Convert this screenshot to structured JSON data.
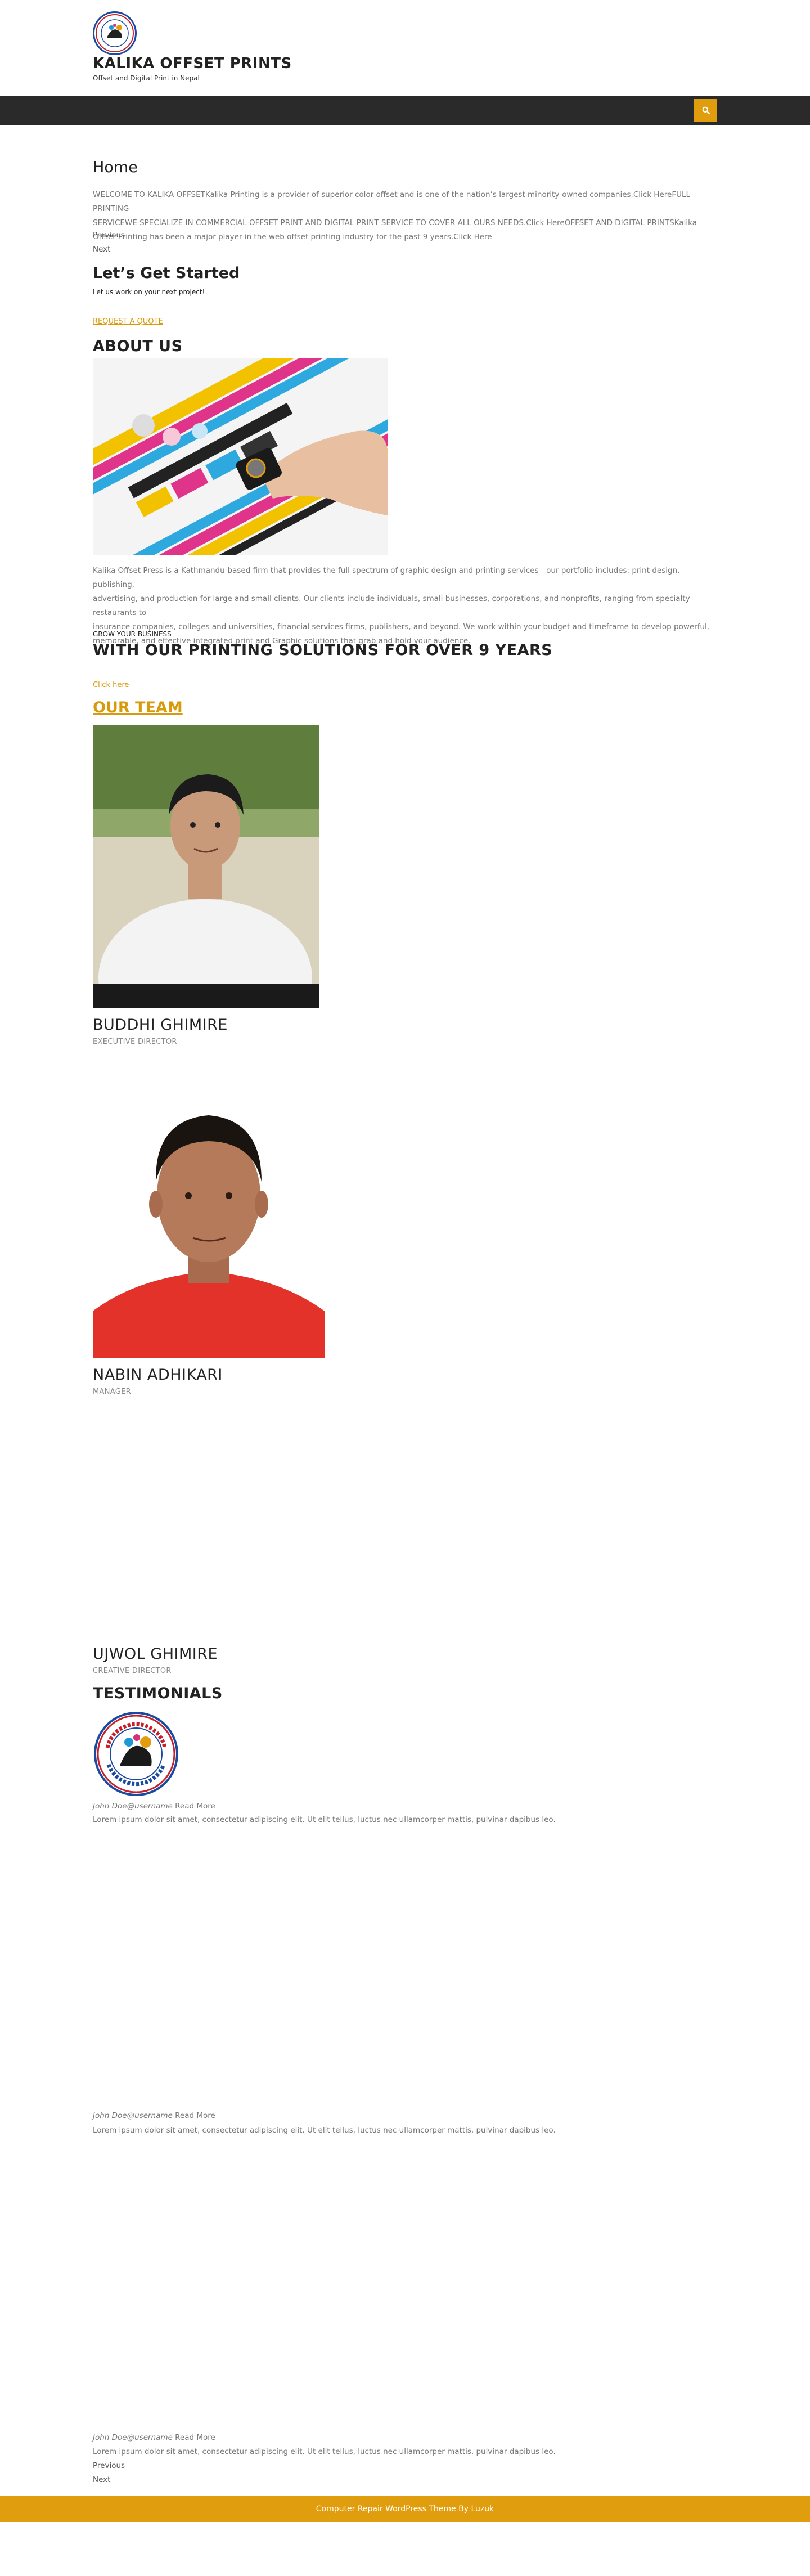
{
  "site": {
    "title": "KALIKA OFFSET PRINTS",
    "tagline": "Offset and Digital Print in Nepal",
    "logo_icon": "kalika-offset-prints-logo"
  },
  "navbar": {
    "search_icon": "search-icon",
    "accent": "#e09e0e",
    "background": "#2a2a2a"
  },
  "home": {
    "heading": "Home",
    "welcome_line1": "WELCOME TO KALIKA OFFSETKalika Printing is a provider of superior color offset and is one of the nation’s largest minority-owned companies.Click HereFULL PRINTING",
    "welcome_line2": "SERVICEWE SPECIALIZE IN COMMERCIAL OFFSET PRINT AND DIGITAL PRINT SERVICE TO COVER ALL OURS NEEDS.Click HereOFFSET AND DIGITAL PRINTSKalika",
    "welcome_line3": "Offset Printing has been a major player in the web offset printing industry for the past 9 years.Click Here",
    "previous": "Previous",
    "next": "Next"
  },
  "get_started": {
    "heading": "Let’s Get Started",
    "subheading": "Let us work on your next project!",
    "cta": "REQUEST A QUOTE"
  },
  "about": {
    "heading": "ABOUT US",
    "line1": "Kalika Offset Press is a Kathmandu-based firm that provides the full spectrum of graphic design and printing services—our portfolio includes: print design, publishing,",
    "line2": "advertising, and production for large and small clients. Our clients include individuals, small businesses, corporations, and nonprofits, ranging from specialty restaurants to",
    "line3": "insurance companies, colleges and universities, financial services firms, publishers, and beyond. We work within your budget and timeframe to develop powerful,",
    "line4": "memorable, and effective integrated print and Graphic solutions that grab and hold your audience.",
    "kicker": "GROW YOUR BUSINESS",
    "tagline": "WITH OUR PRINTING SOLUTIONS FOR OVER 9 YEARS",
    "link": "Click here"
  },
  "team": {
    "heading": "OUR TEAM",
    "members": [
      {
        "name": "BUDDHI GHIMIRE",
        "role": "EXECUTIVE DIRECTOR"
      },
      {
        "name": "NABIN ADHIKARI",
        "role": "MANAGER"
      },
      {
        "name": "UJWOL GHIMIRE",
        "role": "CREATIVE DIRECTOR"
      }
    ]
  },
  "testimonials": {
    "heading": "TESTIMONIALS",
    "items": [
      {
        "author": "John Doe",
        "username": "@username",
        "read_more": "Read More",
        "text": "Lorem ipsum dolor sit amet, consectetur adipiscing elit. Ut elit tellus, luctus nec ullamcorper mattis, pulvinar dapibus leo."
      },
      {
        "author": "John Doe",
        "username": "@username",
        "read_more": "Read More",
        "text": "Lorem ipsum dolor sit amet, consectetur adipiscing elit. Ut elit tellus, luctus nec ullamcorper mattis, pulvinar dapibus leo."
      },
      {
        "author": "John Doe",
        "username": "@username",
        "read_more": "Read More",
        "text": "Lorem ipsum dolor sit amet, consectetur adipiscing elit. Ut elit tellus, luctus nec ullamcorper mattis, pulvinar dapibus leo."
      }
    ],
    "previous": "Previous",
    "next": "Next"
  },
  "footer": {
    "text": "Computer Repair WordPress Theme By Luzuk"
  }
}
